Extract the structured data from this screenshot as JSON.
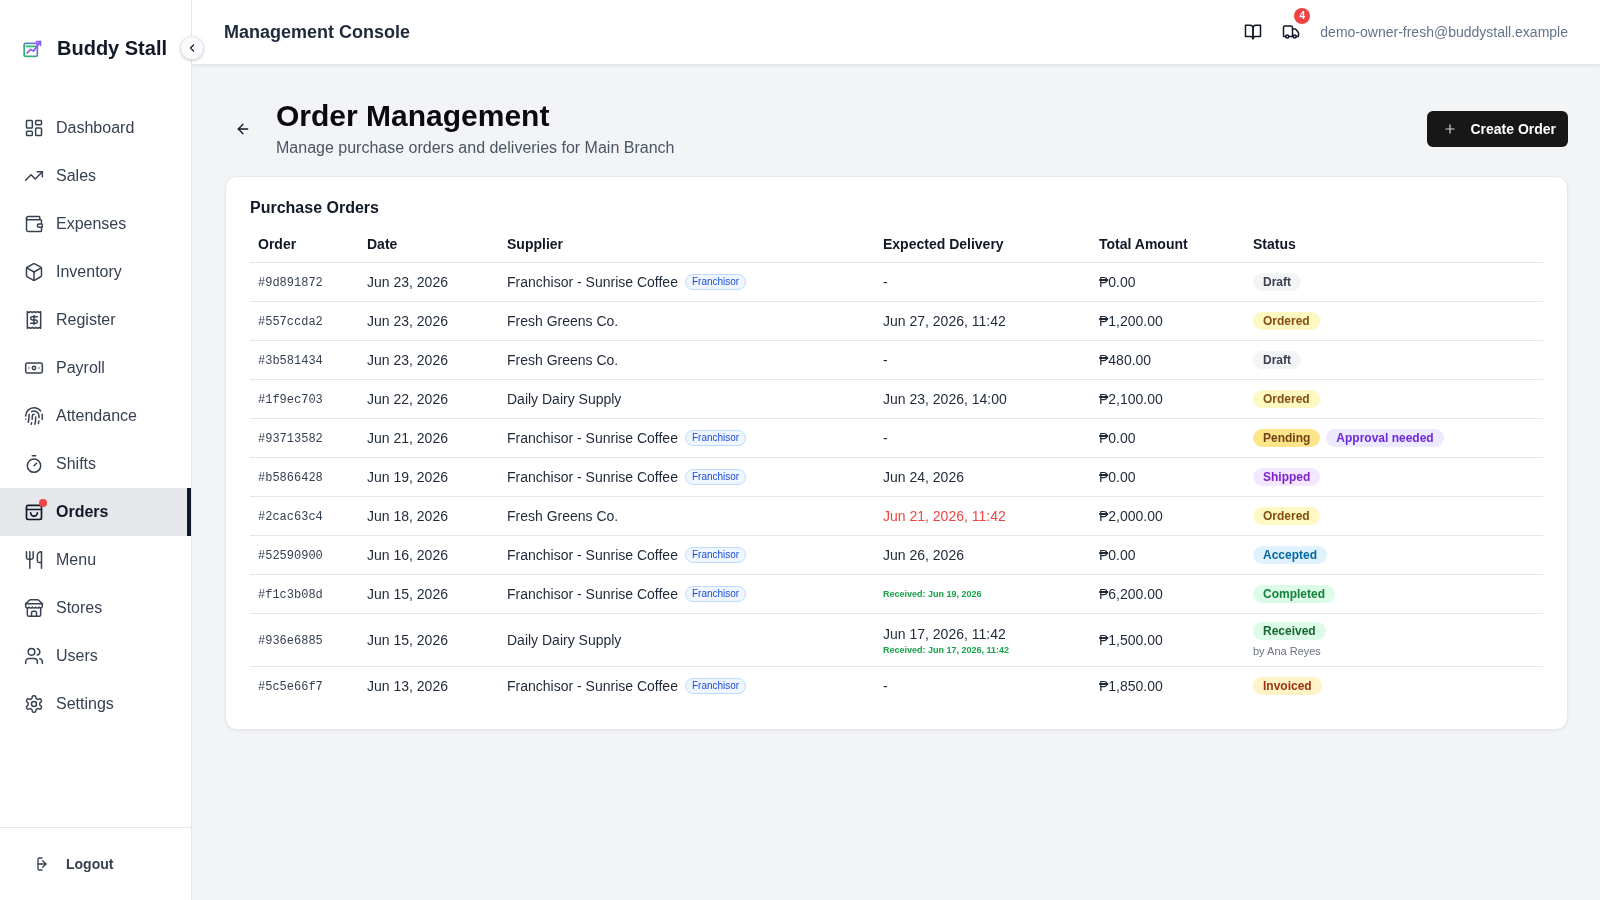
{
  "sidebar": {
    "brand": "Buddy Stall",
    "items": [
      {
        "label": "Dashboard",
        "selected": false,
        "alert": false
      },
      {
        "label": "Sales",
        "selected": false,
        "alert": false
      },
      {
        "label": "Expenses",
        "selected": false,
        "alert": false
      },
      {
        "label": "Inventory",
        "selected": false,
        "alert": false
      },
      {
        "label": "Register",
        "selected": false,
        "alert": false
      },
      {
        "label": "Payroll",
        "selected": false,
        "alert": false
      },
      {
        "label": "Attendance",
        "selected": false,
        "alert": false
      },
      {
        "label": "Shifts",
        "selected": false,
        "alert": false
      },
      {
        "label": "Orders",
        "selected": true,
        "alert": true
      },
      {
        "label": "Menu",
        "selected": false,
        "alert": false
      },
      {
        "label": "Stores",
        "selected": false,
        "alert": false
      },
      {
        "label": "Users",
        "selected": false,
        "alert": false
      },
      {
        "label": "Settings",
        "selected": false,
        "alert": false
      }
    ],
    "logout": "Logout"
  },
  "header": {
    "title": "Management Console",
    "notification_count": "4",
    "user_email": "demo-owner-fresh@buddystall.example"
  },
  "page": {
    "title": "Order Management",
    "subtitle": "Manage purchase orders and deliveries for Main Branch",
    "create_button": "Create Order"
  },
  "orders_card": {
    "title": "Purchase Orders",
    "columns": [
      "Order",
      "Date",
      "Supplier",
      "Expected Delivery",
      "Total Amount",
      "Status"
    ],
    "rows": [
      {
        "order": "#9d891872",
        "date": "Jun 23, 2026",
        "supplier": "Franchisor - Sunrise Coffee",
        "supplier_tag": "Franchisor",
        "expected_delivery": "-",
        "overdue": false,
        "total": "₱0.00",
        "statuses": [
          {
            "label": "Draft",
            "kind": "draft"
          }
        ]
      },
      {
        "order": "#557ccda2",
        "date": "Jun 23, 2026",
        "supplier": "Fresh Greens Co.",
        "expected_delivery": "Jun 27, 2026, 11:42",
        "overdue": false,
        "total": "₱1,200.00",
        "statuses": [
          {
            "label": "Ordered",
            "kind": "ordered"
          }
        ]
      },
      {
        "order": "#3b581434",
        "date": "Jun 23, 2026",
        "supplier": "Fresh Greens Co.",
        "expected_delivery": "-",
        "overdue": false,
        "total": "₱480.00",
        "statuses": [
          {
            "label": "Draft",
            "kind": "draft"
          }
        ]
      },
      {
        "order": "#1f9ec703",
        "date": "Jun 22, 2026",
        "supplier": "Daily Dairy Supply",
        "expected_delivery": "Jun 23, 2026, 14:00",
        "overdue": false,
        "total": "₱2,100.00",
        "statuses": [
          {
            "label": "Ordered",
            "kind": "ordered"
          }
        ]
      },
      {
        "order": "#93713582",
        "date": "Jun 21, 2026",
        "supplier": "Franchisor - Sunrise Coffee",
        "supplier_tag": "Franchisor",
        "expected_delivery": "-",
        "overdue": false,
        "total": "₱0.00",
        "statuses": [
          {
            "label": "Pending",
            "kind": "pending"
          },
          {
            "label": "Approval needed",
            "kind": "approval"
          }
        ]
      },
      {
        "order": "#b5866428",
        "date": "Jun 19, 2026",
        "supplier": "Franchisor - Sunrise Coffee",
        "supplier_tag": "Franchisor",
        "expected_delivery": "Jun 24, 2026",
        "overdue": false,
        "total": "₱0.00",
        "statuses": [
          {
            "label": "Shipped",
            "kind": "shipped"
          }
        ]
      },
      {
        "order": "#2cac63c4",
        "date": "Jun 18, 2026",
        "supplier": "Fresh Greens Co.",
        "expected_delivery": "Jun 21, 2026, 11:42",
        "overdue": true,
        "total": "₱2,000.00",
        "statuses": [
          {
            "label": "Ordered",
            "kind": "ordered"
          }
        ]
      },
      {
        "order": "#52590900",
        "date": "Jun 16, 2026",
        "supplier": "Franchisor - Sunrise Coffee",
        "supplier_tag": "Franchisor",
        "expected_delivery": "Jun 26, 2026",
        "overdue": false,
        "total": "₱0.00",
        "statuses": [
          {
            "label": "Accepted",
            "kind": "accepted"
          }
        ]
      },
      {
        "order": "#f1c3b08d",
        "date": "Jun 15, 2026",
        "supplier": "Franchisor - Sunrise Coffee",
        "supplier_tag": "Franchisor",
        "received": "Received: Jun 19, 2026",
        "total": "₱6,200.00",
        "statuses": [
          {
            "label": "Completed",
            "kind": "completed"
          }
        ]
      },
      {
        "order": "#936e6885",
        "date": "Jun 15, 2026",
        "supplier": "Daily Dairy Supply",
        "expected_delivery": "Jun 17, 2026, 11:42",
        "overdue": false,
        "received": "Received: Jun 17, 2026, 11:42",
        "total": "₱1,500.00",
        "statuses": [
          {
            "label": "Received",
            "kind": "received"
          }
        ],
        "status_note": "by Ana Reyes"
      },
      {
        "order": "#5c5e66f7",
        "date": "Jun 13, 2026",
        "supplier": "Franchisor - Sunrise Coffee",
        "supplier_tag": "Franchisor",
        "expected_delivery": "-",
        "overdue": false,
        "total": "₱1,850.00",
        "statuses": [
          {
            "label": "Invoiced",
            "kind": "invoiced"
          }
        ]
      }
    ]
  }
}
